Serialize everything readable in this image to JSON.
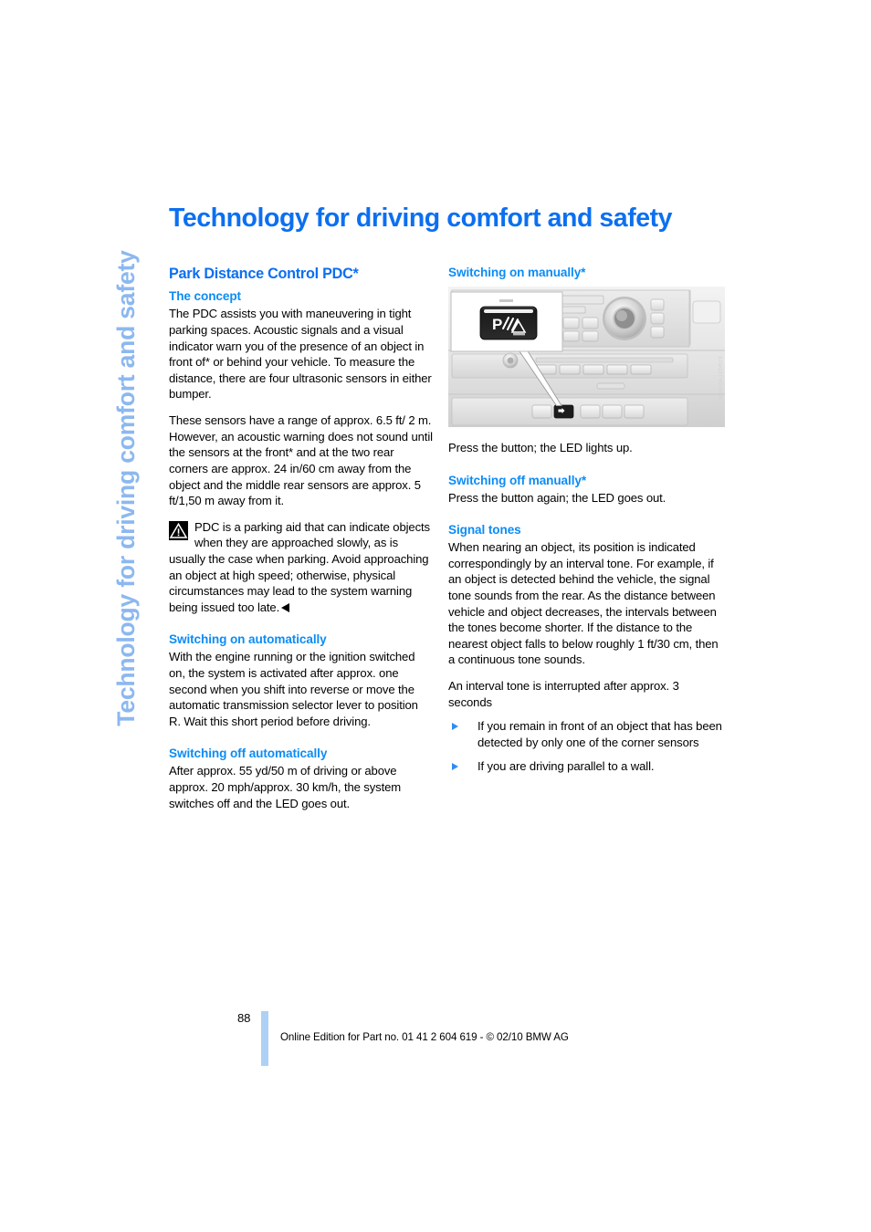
{
  "document": {
    "running_tab": "Technology for driving comfort and safety",
    "chapter_title": "Technology for driving comfort and safety"
  },
  "left_column": {
    "section_title": "Park Distance Control PDC*",
    "concept": {
      "heading": "The concept",
      "paragraph_1_a": "The PDC assists you with maneuvering in tight parking spaces. Acoustic signals and a visual indicator warn you of the presence of an object in front of",
      "paragraph_1_ast": "*",
      "paragraph_1_b": " or behind your vehicle. To measure the distance, there are four ultrasonic sensors in either bumper.",
      "paragraph_2_a": "These sensors have a range of approx. 6.5 ft/ 2 m. However, an acoustic warning does not sound until the sensors at the front",
      "paragraph_2_ast": "*",
      "paragraph_2_b": " and at the two rear corners are approx. 24 in/60 cm away from the object and the middle rear sensors are approx. 5 ft/1,50 m away from it."
    },
    "warning": {
      "icon": "warning-triangle-icon",
      "text": "PDC is a parking aid that can indicate objects when they are approached slowly, as is usually the case when parking. Avoid approaching an object at high speed; otherwise, physical circumstances may lead to the system warning being issued too late."
    },
    "switching_on_auto": {
      "heading": "Switching on automatically",
      "text": "With the engine running or the ignition switched on, the system is activated after approx. one second when you shift into reverse or move the automatic transmission selector lever to position R. Wait this short period before driving."
    },
    "switching_off_auto": {
      "heading": "Switching off automatically",
      "text": "After approx. 55 yd/50 m of driving or above approx. 20 mph/approx. 30 km/h, the system switches off and the LED goes out."
    }
  },
  "right_column": {
    "switching_on_manual": {
      "heading": "Switching on manually*",
      "figure": {
        "name": "center-console-pdc-button-illustration",
        "callout_label": "PDC",
        "figure_id": "BMW-04-1234578"
      },
      "caption": "Press the button; the LED lights up."
    },
    "switching_off_manual": {
      "heading": "Switching off manually*",
      "text": "Press the button again; the LED goes out."
    },
    "signal_tones": {
      "heading": "Signal tones",
      "paragraph_1": "When nearing an object, its position is indicated correspondingly by an interval tone. For example, if an object is detected behind the vehicle, the signal tone sounds from the rear. As the distance between vehicle and object decreases, the intervals between the tones become shorter. If the distance to the nearest object falls to below roughly 1 ft/30 cm, then a continuous tone sounds.",
      "paragraph_2": "An interval tone is interrupted after approx. 3 seconds",
      "bullets": [
        "If you remain in front of an object that has been detected by only one of the corner sensors",
        "If you are driving parallel to a wall."
      ]
    }
  },
  "footer": {
    "page_number": "88",
    "imprint": "Online Edition for Part no. 01 41 2 604 619 - © 02/10 BMW AG"
  },
  "colors": {
    "heading_blue": "#0c6ff0",
    "subheading_blue": "#0c8cf5",
    "tab_blue": "#8cb8f0",
    "footer_bar_blue": "#aed0f5",
    "bullet_blue": "#2f8bf5"
  }
}
